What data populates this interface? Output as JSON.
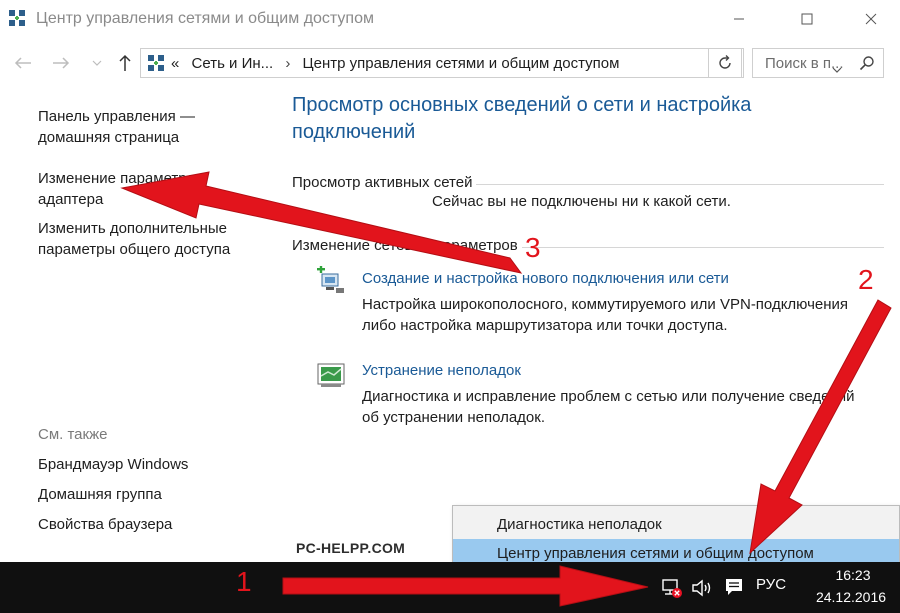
{
  "window": {
    "title": "Центр управления сетями и общим доступом"
  },
  "navbar": {
    "breadcrumb_prefix": "«",
    "breadcrumb_1": "Сеть и Ин...",
    "breadcrumb_sep": "›",
    "breadcrumb_2": "Центр управления сетями и общим доступом",
    "search_placeholder": "Поиск в п..."
  },
  "left_panel": {
    "home_link_line1": "Панель управления —",
    "home_link_line2": "домашняя страница",
    "adapter_line1": "Изменение параметров",
    "adapter_line2": "адаптера",
    "sharing_line1": "Изменить дополнительные",
    "sharing_line2": "параметры общего доступа",
    "see_also": "См. также",
    "see_also_items": [
      "Брандмауэр Windows",
      "Домашняя группа",
      "Свойства браузера"
    ]
  },
  "main": {
    "heading_line1": "Просмотр основных сведений о сети и настройка",
    "heading_line2": "подключений",
    "active_networks_title": "Просмотр активных сетей",
    "not_connected": "Сейчас вы не подключены ни к какой сети.",
    "change_settings_title": "Изменение сетевых параметров",
    "tasks": [
      {
        "link": "Создание и настройка нового подключения или сети",
        "desc_line1": "Настройка широкополосного, коммутируемого или VPN-подключения",
        "desc_line2": "либо настройка маршрутизатора или точки доступа."
      },
      {
        "link": "Устранение неполадок",
        "desc_line1": "Диагностика и исправление проблем с сетью или получение сведений",
        "desc_line2": "об устранении неполадок."
      }
    ]
  },
  "watermark": "PC-HELPP.COM",
  "context_menu": {
    "items": [
      "Диагностика неполадок",
      "Центр управления сетями и общим доступом"
    ],
    "highlighted_index": 1
  },
  "taskbar": {
    "language": "РУС",
    "time": "16:23",
    "date": "24.12.2016"
  },
  "annotations": {
    "step1": "1",
    "step2": "2",
    "step3": "3",
    "arrow_color": "#e2141c"
  },
  "colors": {
    "link": "#1a5a96",
    "taskbar": "#101010",
    "menu_highlight": "#99c9ef"
  },
  "icons": [
    "network-center-icon",
    "back-icon",
    "forward-icon",
    "up-icon",
    "refresh-icon",
    "search-icon",
    "new-connection-icon",
    "troubleshoot-icon",
    "network-error-icon",
    "volume-icon",
    "notifications-icon"
  ]
}
